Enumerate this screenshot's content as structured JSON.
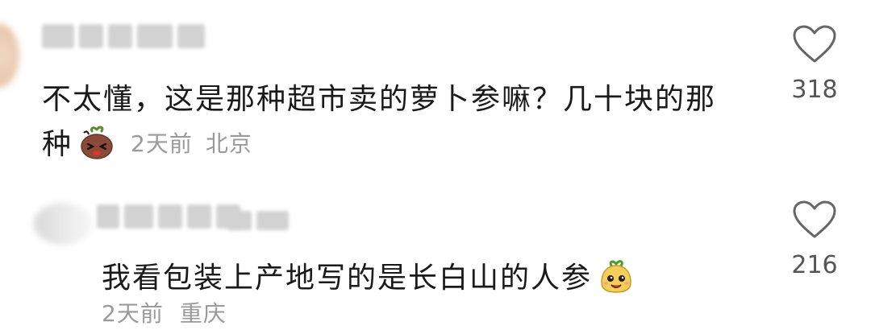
{
  "comments": [
    {
      "text": "不太懂，这是那种超市卖的萝卜参嘛？几十块的那种",
      "emoji_icon": "radish-face-emoji",
      "time": "2天前",
      "location": "北京",
      "likes": "318"
    },
    {
      "text": "我看包装上产地写的是长白山的人参",
      "emoji_icon": "ginseng-face-emoji",
      "time": "2天前",
      "location": "重庆",
      "likes": "216"
    }
  ],
  "colors": {
    "text": "#1a1a1a",
    "meta": "#9a9a9a",
    "like_icon": "#666666"
  }
}
